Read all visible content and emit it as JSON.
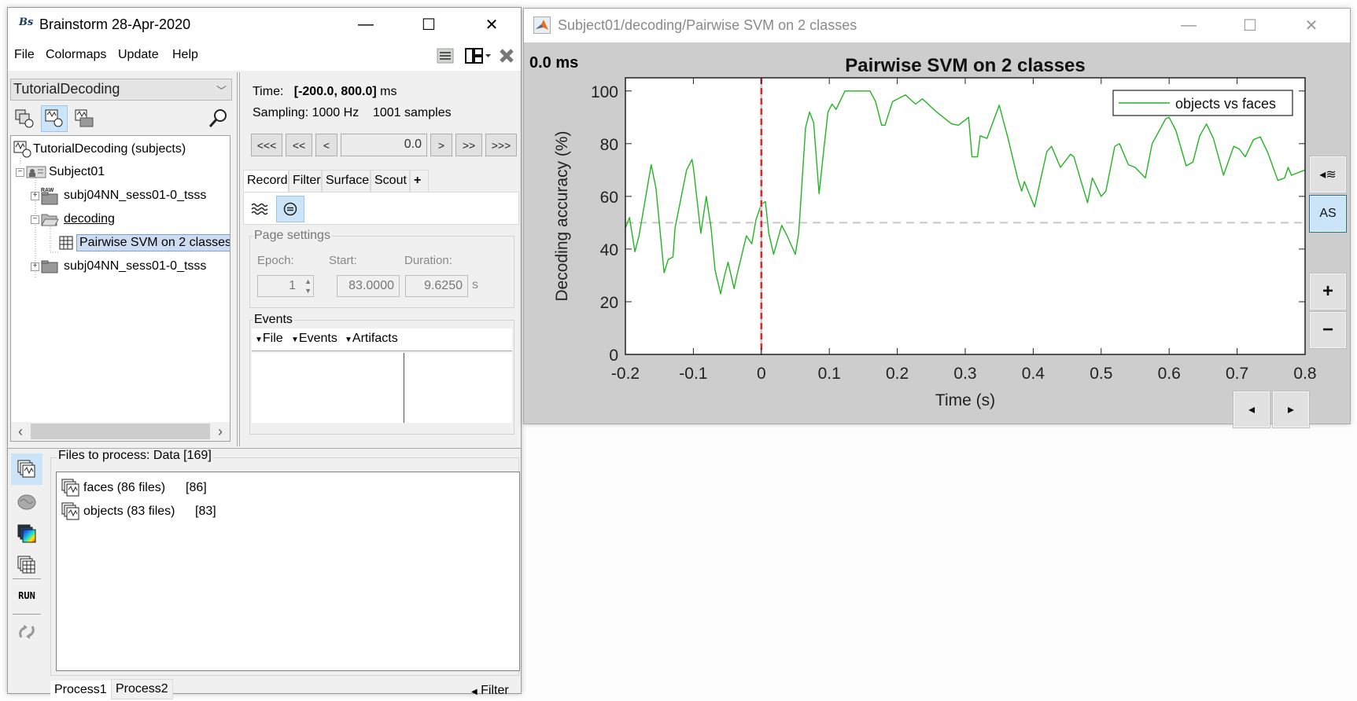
{
  "main_window": {
    "logo": "Bs",
    "title": "Brainstorm 28-Apr-2020",
    "controls": {
      "minimize": "—",
      "maximize": "☐",
      "close": "✕"
    },
    "menu": [
      "File",
      "Colormaps",
      "Update",
      "Help"
    ],
    "protocol_selector": "TutorialDecoding",
    "tree": {
      "root": "TutorialDecoding (subjects)",
      "nodes": [
        {
          "label": "Subject01",
          "icon": "subject-icon",
          "expander": "−"
        },
        {
          "label": "subj04NN_sess01-0_tsss",
          "icon": "raw-folder-icon",
          "expander": "+",
          "badge": "RAW"
        },
        {
          "label": "decoding",
          "icon": "open-folder-icon",
          "expander": "−"
        },
        {
          "label": "Pairwise SVM on 2 classes",
          "icon": "matrix-icon",
          "selected": true
        },
        {
          "label": "subj04NN_sess01-0_tsss",
          "icon": "folder-icon",
          "expander": "+"
        }
      ]
    },
    "time_panel": {
      "time_label": "Time:",
      "time_range": "[-200.0, 800.0]",
      "time_unit": "ms",
      "sampling": "Sampling: 1000 Hz",
      "samples": "1001 samples",
      "nav_buttons": [
        "<<<",
        "<<",
        "<",
        ">",
        ">>",
        ">>>"
      ],
      "current_time": "0.0"
    },
    "tabs": [
      "Record",
      "Filter",
      "Surface",
      "Scout",
      "+"
    ],
    "active_tab": "Record",
    "page_settings": {
      "title": "Page settings",
      "epoch_label": "Epoch:",
      "epoch_value": "1",
      "start_label": "Start:",
      "start_value": "83.0000",
      "duration_label": "Duration:",
      "duration_value": "9.6250",
      "duration_unit": "s"
    },
    "events": {
      "title": "Events",
      "menus": [
        "File",
        "Events",
        "Artifacts"
      ]
    },
    "process": {
      "header": "Files to process: Data [169]",
      "files": [
        {
          "label": "faces (86 files)",
          "count": "[86]"
        },
        {
          "label": "objects (83 files)",
          "count": "[83]"
        }
      ],
      "run_label": "RUN",
      "tabs": [
        "Process1",
        "Process2"
      ],
      "filter_label": "Filter"
    }
  },
  "figure_window": {
    "title": "Subject01/decoding/Pairwise SVM on 2 classes",
    "current_time": "0.0 ms",
    "side_buttons": {
      "display_mode": "◂≋",
      "autoscale": "AS",
      "zoom_in": "+",
      "zoom_out": "−"
    },
    "nav_buttons": {
      "prev": "◂",
      "next": "▸"
    }
  },
  "colors": {
    "series": "#22b422",
    "cursor": "#e8191f",
    "chance_line": "#c8c8c8",
    "selection": "#cce4f7"
  },
  "chart_data": {
    "type": "line",
    "title": "Pairwise SVM on 2 classes",
    "xlabel": "Time (s)",
    "ylabel": "Decoding accuracy (%)",
    "xlim": [
      -0.2,
      0.8
    ],
    "ylim": [
      0,
      105
    ],
    "xticks": [
      -0.2,
      -0.1,
      0,
      0.1,
      0.2,
      0.3,
      0.4,
      0.5,
      0.6,
      0.7,
      0.8
    ],
    "xtick_labels": [
      "-0.2",
      "-0.1",
      "0",
      "0.1",
      "0.2",
      "0.3",
      "0.4",
      "0.5",
      "0.6",
      "0.7",
      "0.8"
    ],
    "yticks": [
      0,
      20,
      40,
      60,
      80,
      100
    ],
    "ytick_labels": [
      "0",
      "20",
      "40",
      "60",
      "80",
      "100"
    ],
    "grid": false,
    "legend": {
      "position": "top-right",
      "entries": [
        "objects vs faces"
      ]
    },
    "cursor_time": 0,
    "chance_level": 50,
    "series": [
      {
        "name": "objects vs faces",
        "x": [
          -0.2,
          -0.194,
          -0.186,
          -0.18,
          -0.172,
          -0.162,
          -0.155,
          -0.143,
          -0.137,
          -0.13,
          -0.127,
          -0.11,
          -0.102,
          -0.1,
          -0.089,
          -0.081,
          -0.074,
          -0.068,
          -0.06,
          -0.054,
          -0.049,
          -0.04,
          -0.036,
          -0.022,
          -0.014,
          -0.008,
          0,
          0.006,
          0.011,
          0.018,
          0.03,
          0.038,
          0.05,
          0.055,
          0.065,
          0.071,
          0.077,
          0.085,
          0.092,
          0.098,
          0.104,
          0.11,
          0.123,
          0.16,
          0.168,
          0.177,
          0.182,
          0.193,
          0.212,
          0.227,
          0.237,
          0.258,
          0.28,
          0.29,
          0.305,
          0.31,
          0.318,
          0.322,
          0.332,
          0.35,
          0.363,
          0.377,
          0.383,
          0.387,
          0.402,
          0.42,
          0.427,
          0.44,
          0.455,
          0.46,
          0.47,
          0.48,
          0.487,
          0.5,
          0.507,
          0.52,
          0.527,
          0.54,
          0.55,
          0.565,
          0.575,
          0.595,
          0.6,
          0.61,
          0.625,
          0.635,
          0.645,
          0.655,
          0.665,
          0.68,
          0.695,
          0.703,
          0.712,
          0.724,
          0.734,
          0.745,
          0.76,
          0.77,
          0.775,
          0.78,
          0.8
        ],
        "y": [
          48,
          52,
          39,
          45,
          57,
          72,
          63,
          31,
          36,
          37,
          48,
          70,
          74,
          71,
          46,
          60,
          48,
          32,
          23,
          30,
          35,
          25,
          30,
          45,
          42,
          51,
          57,
          58,
          46,
          38,
          49,
          45,
          38,
          46,
          86,
          92,
          88,
          61,
          78,
          92,
          95,
          93,
          100,
          100,
          96,
          87,
          87,
          96,
          98.5,
          95,
          97,
          92,
          87.5,
          87,
          90,
          75,
          75,
          83,
          82,
          94.6,
          82,
          67,
          62,
          65.6,
          56,
          77,
          79,
          71,
          76,
          75,
          66,
          57.6,
          67,
          60,
          62,
          79,
          80,
          72,
          71,
          67,
          80,
          89.5,
          90,
          85,
          71.6,
          73,
          83,
          87.5,
          82,
          68,
          79,
          78,
          75,
          81.5,
          82.6,
          76.7,
          66,
          67,
          71,
          68,
          70
        ]
      }
    ]
  }
}
